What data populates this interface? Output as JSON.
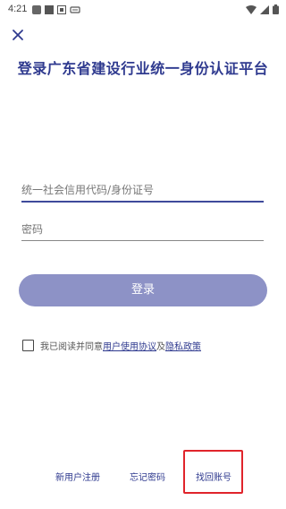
{
  "status_bar": {
    "time": "4:21",
    "icons_left": [
      "gear-icon",
      "square-icon",
      "notification-a-icon",
      "mini-icon"
    ],
    "icons_right": [
      "wifi-icon",
      "signal-icon",
      "battery-icon"
    ]
  },
  "header": {
    "close_icon": "close-icon",
    "title": "登录广东省建设行业统一身份认证平台"
  },
  "form": {
    "account_placeholder": "统一社会信用代码/身份证号",
    "account_value": "",
    "password_placeholder": "密码",
    "password_value": "",
    "login_label": "登录"
  },
  "agreement": {
    "checked": false,
    "prefix": "我已阅读并同意",
    "user_agreement": "用户使用协议",
    "conjunction": "及",
    "privacy_policy": "隐私政策"
  },
  "footer": {
    "register_label": "新用户注册",
    "forgot_label": "忘记密码",
    "recover_label": "找回账号"
  },
  "colors": {
    "accent": "#2f3a8f",
    "button": "#8d92c6",
    "highlight": "#e0242b"
  }
}
